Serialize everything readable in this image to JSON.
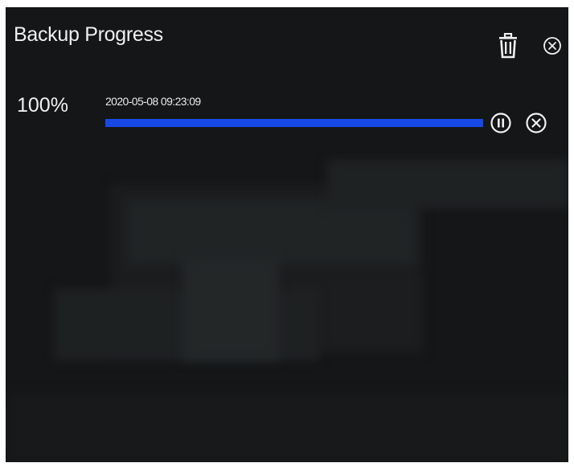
{
  "dialog": {
    "title": "Backup Progress",
    "icons": {
      "delete": "trash-icon",
      "close": "close-circle-icon"
    }
  },
  "backup_item": {
    "percent_label": "100%",
    "progress_fraction": 1.0,
    "timestamp": "2020-05-08 09:23:09",
    "icons": {
      "pause": "pause-circle-icon",
      "cancel": "cancel-circle-icon"
    }
  },
  "colors": {
    "background": "#141617",
    "text": "#f0f0f0",
    "progress_fill": "#1749e6"
  }
}
